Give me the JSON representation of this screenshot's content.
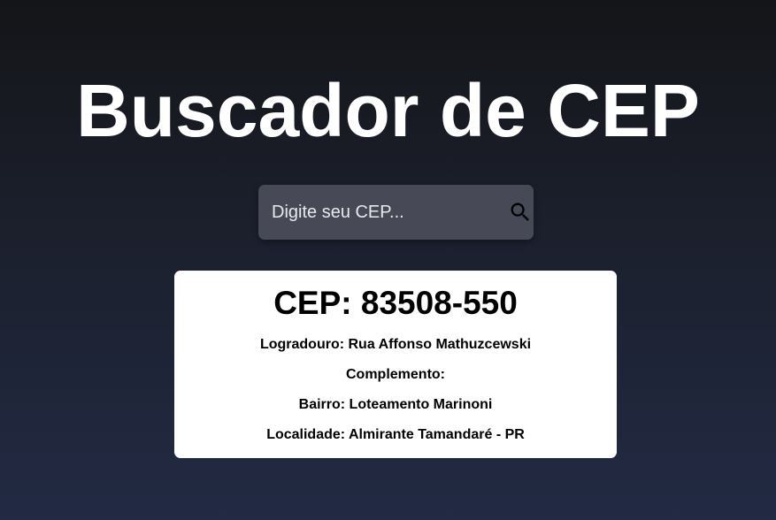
{
  "header": {
    "title": "Buscador de CEP"
  },
  "search": {
    "placeholder": "Digite seu CEP...",
    "value": "",
    "button_icon": "search-icon"
  },
  "result": {
    "cep_label": "CEP: 83508-550",
    "logradouro": "Logradouro: Rua Affonso Mathuzcewski",
    "complemento": "Complemento:",
    "bairro": "Bairro: Loteamento Marinoni",
    "localidade": "Localidade: Almirante Tamandaré - PR"
  },
  "colors": {
    "background_top": "#141518",
    "background_bottom": "#222a44",
    "search_box": "#474a56",
    "card": "#ffffff",
    "title_text": "#ffffff"
  }
}
